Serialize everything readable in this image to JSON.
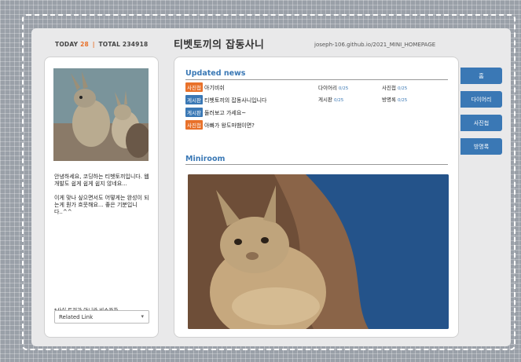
{
  "header": {
    "today_label": "TODAY",
    "today_count": "28",
    "separator": "|",
    "total_label": "TOTAL 234918",
    "site_title": "티벳토끼의 잡동사니",
    "site_url": "joseph-106.github.io/2021_MINI_HOMEPAGE"
  },
  "profile": {
    "intro_1": "안녕하세요, 코딩하는 티벳토끼입니다. 웹 개발도 쉽게 쉽게 쉽지 않네요...",
    "intro_2": "이게 맞나 싶으면서도 어떻게는 완성이 되는게 뭔가 흐뭇해요... 좋은 기분입니다..^^",
    "note": "*사실 토끼가 아니라 비스카차",
    "related_link": "Related Link",
    "related_arrow": "▾"
  },
  "news": {
    "title": "Updated news",
    "items": [
      {
        "tag": "사진첩",
        "tag_color": "orange",
        "text": "아기비쉬"
      },
      {
        "tag": "게시판",
        "tag_color": "blue",
        "text": "티벳토끼의 잡동사니입니다"
      },
      {
        "tag": "게시판",
        "tag_color": "blue",
        "text": "둘러보고 가세요~"
      },
      {
        "tag": "사진첩",
        "tag_color": "orange",
        "text": "아빠가 왕도마뱀이면?"
      }
    ],
    "stats": [
      {
        "label": "다이어리",
        "count": "0/25"
      },
      {
        "label": "사진첩",
        "count": "0/25"
      },
      {
        "label": "게시판",
        "count": "0/25"
      },
      {
        "label": "방명록",
        "count": "0/25"
      }
    ]
  },
  "miniroom": {
    "title": "Miniroom"
  },
  "tabs": [
    "홈",
    "다이어리",
    "사진첩",
    "방명록"
  ],
  "colors": {
    "accent_blue": "#3a78b5",
    "accent_orange": "#e8712a"
  }
}
